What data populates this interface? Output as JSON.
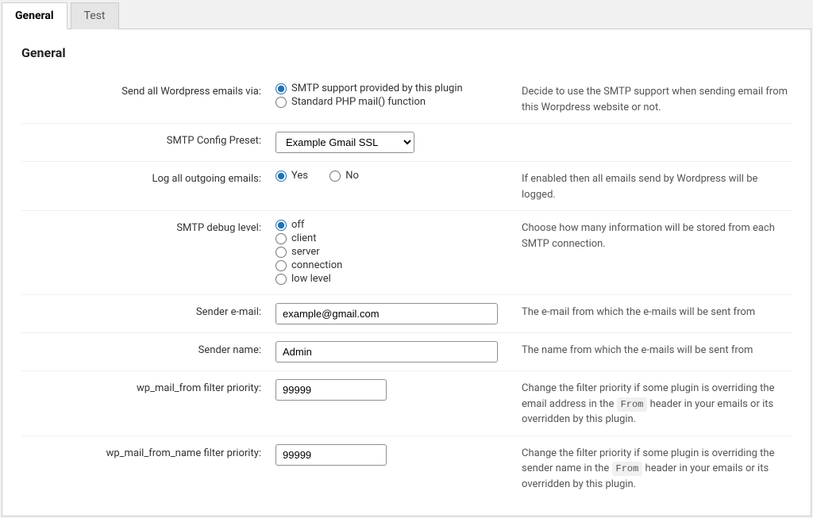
{
  "tabs": [
    {
      "label": "General",
      "active": true
    },
    {
      "label": "Test",
      "active": false
    }
  ],
  "section_title": "General",
  "rows": {
    "send_via": {
      "label": "Send all Wordpress emails via:",
      "options": [
        {
          "label": "SMTP support provided by this plugin",
          "checked": true
        },
        {
          "label": "Standard PHP mail() function",
          "checked": false
        }
      ],
      "desc": "Decide to use the SMTP support when sending email from this Worpdress website or not."
    },
    "preset": {
      "label": "SMTP Config Preset:",
      "value": "Example Gmail SSL"
    },
    "log": {
      "label": "Log all outgoing emails:",
      "options": [
        {
          "label": "Yes",
          "checked": true
        },
        {
          "label": "No",
          "checked": false
        }
      ],
      "desc": "If enabled then all emails send by Wordpress will be logged."
    },
    "debug": {
      "label": "SMTP debug level:",
      "options": [
        {
          "label": "off",
          "checked": true
        },
        {
          "label": "client",
          "checked": false
        },
        {
          "label": "server",
          "checked": false
        },
        {
          "label": "connection",
          "checked": false
        },
        {
          "label": "low level",
          "checked": false
        }
      ],
      "desc": "Choose how many information will be stored from each SMTP connection."
    },
    "sender_email": {
      "label": "Sender e-mail:",
      "value": "example@gmail.com",
      "desc": "The e-mail from which the e-mails will be sent from"
    },
    "sender_name": {
      "label": "Sender name:",
      "value": "Admin",
      "desc": "The name from which the e-mails will be sent from"
    },
    "from_priority": {
      "label": "wp_mail_from filter priority:",
      "value": "99999",
      "desc_pre": "Change the filter priority if some plugin is overriding the email address in the ",
      "code": "From",
      "desc_post": " header in your emails or its overridden by this plugin."
    },
    "from_name_priority": {
      "label": "wp_mail_from_name filter priority:",
      "value": "99999",
      "desc_pre": "Change the filter priority if some plugin is overriding the sender name in the ",
      "code": "From",
      "desc_post": " header in your emails or its overridden by this plugin."
    }
  }
}
